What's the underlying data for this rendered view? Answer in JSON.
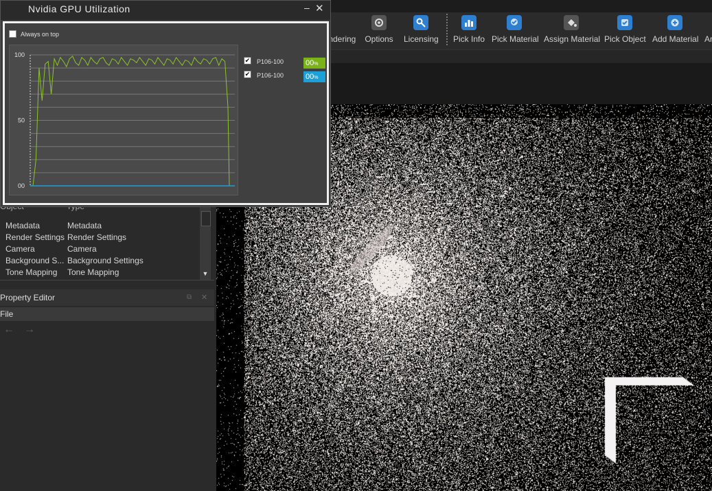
{
  "toolbar": {
    "items": [
      {
        "label": "endering",
        "icon": "rendering-icon"
      },
      {
        "label": "Options",
        "icon": "gear-icon"
      },
      {
        "label": "Licensing",
        "icon": "key-icon"
      },
      {
        "label": "Pick Info",
        "icon": "bar-chart-icon"
      },
      {
        "label": "Pick Material",
        "icon": "pick-material-icon"
      },
      {
        "label": "Assign Material",
        "icon": "paint-bucket-icon"
      },
      {
        "label": "Pick Object",
        "icon": "pick-object-icon"
      },
      {
        "label": "Add Material",
        "icon": "add-material-icon"
      },
      {
        "label": "Ar",
        "icon": ""
      }
    ],
    "accent": "#4a90d9"
  },
  "outliner": {
    "col_object": "Object",
    "col_type": "Type",
    "rows": [
      {
        "object": "Metadata",
        "type": "Metadata"
      },
      {
        "object": "Render Settings",
        "type": "Render Settings"
      },
      {
        "object": "Camera",
        "type": "Camera"
      },
      {
        "object": "Background S...",
        "type": "Background Settings"
      },
      {
        "object": "Tone Mapping",
        "type": "Tone Mapping"
      }
    ]
  },
  "property_editor": {
    "title": "Property Editor",
    "menu_file": "File",
    "back_arrow": "←",
    "forward_arrow": "→"
  },
  "gpu_window": {
    "title": "Nvidia GPU Utilization",
    "minimize": "–",
    "close": "✕",
    "always_on_top": "Always on top",
    "y_ticks": [
      "100",
      "50",
      "00"
    ],
    "gpus": [
      {
        "name": "P106-100",
        "checked": true,
        "value": "00",
        "unit": "%",
        "color": "#7ab317"
      },
      {
        "name": "P106-100",
        "checked": true,
        "value": "00",
        "unit": "%",
        "color": "#1ca0d8"
      }
    ]
  },
  "chart_data": {
    "type": "line",
    "ylim": [
      0,
      100
    ],
    "grid": true,
    "series": [
      {
        "color": "#8ec32b",
        "values": [
          0,
          20,
          90,
          65,
          93,
          95,
          70,
          97,
          92,
          98,
          95,
          91,
          97,
          99,
          94,
          92,
          98,
          96,
          92,
          98,
          95,
          93,
          97,
          98,
          94,
          92,
          97,
          96,
          93,
          98,
          95,
          92,
          97,
          96,
          94,
          98,
          95,
          92,
          97,
          96,
          93,
          98,
          95,
          92,
          97,
          96,
          93,
          98,
          95,
          92,
          96,
          95,
          92,
          98,
          95,
          93,
          97,
          96,
          93,
          97,
          98,
          92,
          97,
          95,
          60,
          0
        ]
      },
      {
        "color": "#1ca0d8",
        "values": [
          0,
          0
        ]
      }
    ]
  }
}
